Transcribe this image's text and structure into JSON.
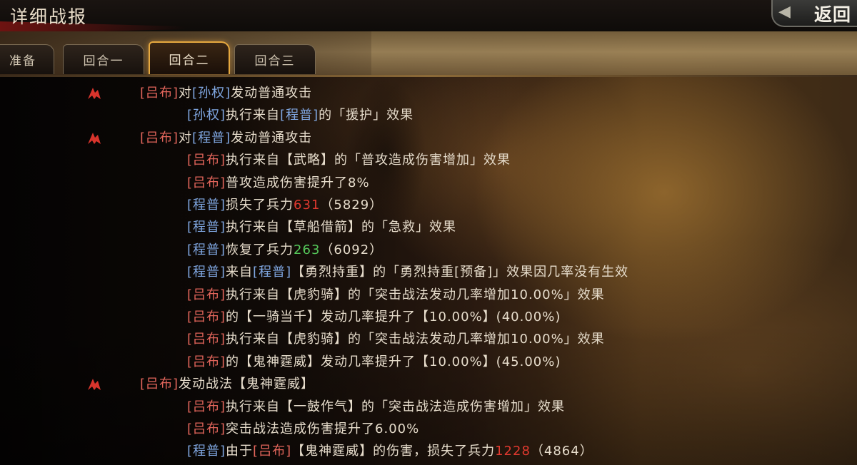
{
  "header": {
    "title": "详细战报",
    "back_label": "返回"
  },
  "tabs": [
    {
      "label": "准备",
      "active": false
    },
    {
      "label": "回合一",
      "active": false
    },
    {
      "label": "回合二",
      "active": true
    },
    {
      "label": "回合三",
      "active": false
    }
  ],
  "colors": {
    "hero_red": "#e2655b",
    "hero_blue": "#7fa6e0",
    "loss_red": "#e0392f",
    "heal_green": "#55c85a",
    "active_tab_border": "#e5a83f"
  },
  "log": [
    {
      "level": 1,
      "marker": true,
      "segments": [
        {
          "text": "[吕布]",
          "style": "red"
        },
        {
          "text": "对"
        },
        {
          "text": "[孙权]",
          "style": "blue"
        },
        {
          "text": "发动普通攻击"
        }
      ]
    },
    {
      "level": 2,
      "segments": [
        {
          "text": "[孙权]",
          "style": "blue"
        },
        {
          "text": "执行来自"
        },
        {
          "text": "[程普]",
          "style": "blue"
        },
        {
          "text": "的「援护」效果"
        }
      ]
    },
    {
      "level": 1,
      "marker": true,
      "segments": [
        {
          "text": "[吕布]",
          "style": "red"
        },
        {
          "text": "对"
        },
        {
          "text": "[程普]",
          "style": "blue"
        },
        {
          "text": "发动普通攻击"
        }
      ]
    },
    {
      "level": 2,
      "segments": [
        {
          "text": "[吕布]",
          "style": "red"
        },
        {
          "text": "执行来自【武略】的「普攻造成伤害增加」效果"
        }
      ]
    },
    {
      "level": 2,
      "segments": [
        {
          "text": "[吕布]",
          "style": "red"
        },
        {
          "text": "普攻造成伤害提升了8%"
        }
      ]
    },
    {
      "level": 2,
      "segments": [
        {
          "text": "[程普]",
          "style": "blue"
        },
        {
          "text": "损失了兵力"
        },
        {
          "text": "631",
          "style": "loss"
        },
        {
          "text": "（5829）"
        }
      ]
    },
    {
      "level": 2,
      "segments": [
        {
          "text": "[程普]",
          "style": "blue"
        },
        {
          "text": "执行来自【草船借箭】的「急救」效果"
        }
      ]
    },
    {
      "level": 2,
      "segments": [
        {
          "text": "[程普]",
          "style": "blue"
        },
        {
          "text": "恢复了兵力"
        },
        {
          "text": "263",
          "style": "heal"
        },
        {
          "text": "（6092）"
        }
      ]
    },
    {
      "level": 2,
      "segments": [
        {
          "text": "[程普]",
          "style": "blue"
        },
        {
          "text": "来自"
        },
        {
          "text": "[程普]",
          "style": "blue"
        },
        {
          "text": "【勇烈持重】的「勇烈持重[预备]」效果因几率没有生效"
        }
      ]
    },
    {
      "level": 2,
      "segments": [
        {
          "text": "[吕布]",
          "style": "red"
        },
        {
          "text": "执行来自【虎豹骑】的「突击战法发动几率增加10.00%」效果"
        }
      ]
    },
    {
      "level": 2,
      "segments": [
        {
          "text": "[吕布]",
          "style": "red"
        },
        {
          "text": "的【一骑当千】发动几率提升了【10.00%】(40.00%)"
        }
      ]
    },
    {
      "level": 2,
      "segments": [
        {
          "text": "[吕布]",
          "style": "red"
        },
        {
          "text": "执行来自【虎豹骑】的「突击战法发动几率增加10.00%」效果"
        }
      ]
    },
    {
      "level": 2,
      "segments": [
        {
          "text": "[吕布]",
          "style": "red"
        },
        {
          "text": "的【鬼神霆威】发动几率提升了【10.00%】(45.00%)"
        }
      ]
    },
    {
      "level": 1,
      "marker": true,
      "segments": [
        {
          "text": "[吕布]",
          "style": "red"
        },
        {
          "text": "发动战法【鬼神霆威】"
        }
      ]
    },
    {
      "level": 2,
      "segments": [
        {
          "text": "[吕布]",
          "style": "red"
        },
        {
          "text": "执行来自【一鼓作气】的「突击战法造成伤害增加」效果"
        }
      ]
    },
    {
      "level": 2,
      "segments": [
        {
          "text": "[吕布]",
          "style": "red"
        },
        {
          "text": "突击战法造成伤害提升了6.00%"
        }
      ]
    },
    {
      "level": 2,
      "segments": [
        {
          "text": "[程普]",
          "style": "blue"
        },
        {
          "text": "由于"
        },
        {
          "text": "[吕布]",
          "style": "red"
        },
        {
          "text": "【鬼神霆威】的伤害，损失了兵力"
        },
        {
          "text": "1228",
          "style": "loss"
        },
        {
          "text": "（4864）"
        }
      ]
    }
  ]
}
